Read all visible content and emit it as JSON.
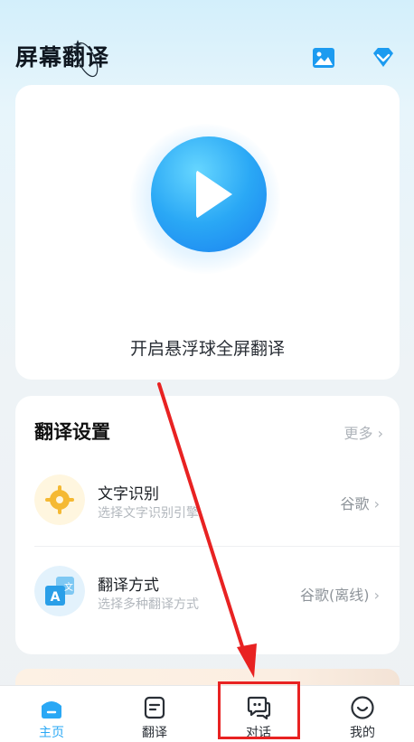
{
  "header": {
    "title": "屏幕翻译"
  },
  "hero": {
    "caption": "开启悬浮球全屏翻译"
  },
  "settings": {
    "title": "翻译设置",
    "more": "更多",
    "rows": [
      {
        "name": "文字识别",
        "sub": "选择文字识别引擎",
        "value": "谷歌"
      },
      {
        "name": "翻译方式",
        "sub": "选择多种翻译方式",
        "value": "谷歌(离线)"
      }
    ]
  },
  "tabbar": {
    "tabs": [
      {
        "label": "主页",
        "active": true
      },
      {
        "label": "翻译",
        "active": false
      },
      {
        "label": "对话",
        "active": false
      },
      {
        "label": "我的",
        "active": false
      }
    ]
  },
  "colors": {
    "accent": "#2aa8f5",
    "highlight": "#e82222"
  }
}
